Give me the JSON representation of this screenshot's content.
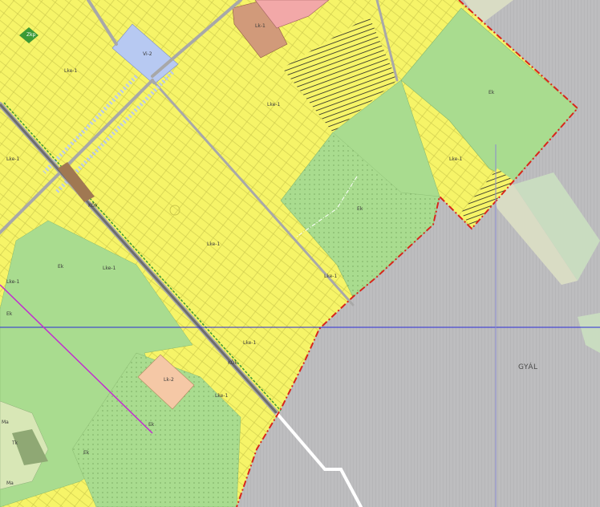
{
  "map": {
    "colors": {
      "outside": "#b9b9bb",
      "residential": "#f6f468",
      "green": "#a9dc8f",
      "green_light": "#bfe7a8",
      "institutional": "#b7c9f2",
      "commercial": "#f2a8a8",
      "special": "#d19a7a",
      "industrial": "#f5c8a6",
      "road": "#a8a8a8",
      "boundary": "#d8261b",
      "railway": "#6d6d6d",
      "blue_line": "#2b2bd9",
      "purple_line": "#c22bd0"
    },
    "place_names": {
      "gyal": "GYÁL"
    },
    "zone_labels": {
      "zkp": "Zkp",
      "vi2": "Vi-2",
      "lk1_top": "Lk-1",
      "lke1_a": "Lke-1",
      "lke1_b": "Lke-1",
      "lke1_c": "Lke-1",
      "lke1_d": "Lke-1",
      "lke1_e": "Lke-1",
      "lke1_f": "Lke-1",
      "lke1_g": "Lke-1",
      "lke1_h": "Lke-1",
      "lke1_i": "Lke-1",
      "lke1_j": "Lke-1",
      "kok_a": "KÖk",
      "kok_b": "KÖk",
      "ek_a": "Ek",
      "ek_b": "Ek",
      "ek_c": "Ek",
      "ek_d": "Ek",
      "ek_e": "Ek",
      "ek_f": "Ek",
      "lk2": "Lk-2",
      "ma_a": "Ma",
      "ma_b": "Ma",
      "tk": "Tk"
    }
  }
}
